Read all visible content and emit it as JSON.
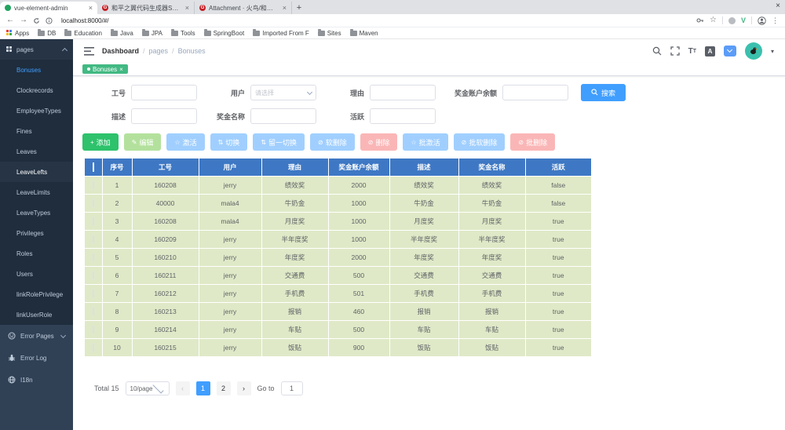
{
  "browser": {
    "tabs": [
      {
        "title": "vue-element-admin",
        "favicon": "green-dot",
        "active": true
      },
      {
        "title": "和平之翼代码生成器SMEU",
        "favicon": "gitee",
        "active": false
      },
      {
        "title": "Attachment · 火鸟/和平之翼",
        "favicon": "gitee",
        "active": false
      }
    ],
    "new_tab_label": "+",
    "window_close_label": "×",
    "url": "localhost:8000/#/",
    "bookmarks": [
      "Apps",
      "DB",
      "Education",
      "Java",
      "JPA",
      "Tools",
      "SpringBoot",
      "Imported From F",
      "Sites",
      "Maven"
    ]
  },
  "sidebar": {
    "group_label": "pages",
    "pages_items": [
      {
        "label": "Bonuses",
        "active": true,
        "hover": false
      },
      {
        "label": "Clockrecords",
        "active": false,
        "hover": false
      },
      {
        "label": "EmployeeTypes",
        "active": false,
        "hover": false
      },
      {
        "label": "Fines",
        "active": false,
        "hover": false
      },
      {
        "label": "Leaves",
        "active": false,
        "hover": false
      },
      {
        "label": "LeaveLefts",
        "active": false,
        "hover": true
      },
      {
        "label": "LeaveLimits",
        "active": false,
        "hover": false
      },
      {
        "label": "LeaveTypes",
        "active": false,
        "hover": false
      },
      {
        "label": "Privileges",
        "active": false,
        "hover": false
      },
      {
        "label": "Roles",
        "active": false,
        "hover": false
      },
      {
        "label": "Users",
        "active": false,
        "hover": false
      },
      {
        "label": "linkRolePrivilege",
        "active": false,
        "hover": false
      },
      {
        "label": "linkUserRole",
        "active": false,
        "hover": false
      }
    ],
    "other_items": [
      {
        "label": "Error Pages",
        "icon": "error-pages-icon",
        "chevron": true
      },
      {
        "label": "Error Log",
        "icon": "bug-icon",
        "chevron": false
      },
      {
        "label": "I18n",
        "icon": "globe-icon",
        "chevron": false
      }
    ]
  },
  "navbar": {
    "breadcrumb": [
      "Dashboard",
      "pages",
      "Bonuses"
    ],
    "separator": "/"
  },
  "tags": [
    {
      "label": "Bonuses",
      "close": "×",
      "active": true
    }
  ],
  "filter": {
    "rows": [
      [
        {
          "label": "工号",
          "type": "input"
        },
        {
          "label": "用户",
          "type": "select",
          "placeholder": "请选择"
        },
        {
          "label": "理由",
          "type": "input"
        },
        {
          "label": "奖金账户余额",
          "type": "input",
          "wide": true
        }
      ],
      [
        {
          "label": "描述",
          "type": "input"
        },
        {
          "label": "奖金名称",
          "type": "input"
        },
        {
          "label": "活跃",
          "type": "input"
        }
      ]
    ],
    "search_label": "搜索"
  },
  "toolbar": {
    "buttons": [
      {
        "label": "添加",
        "icon": "plus-icon",
        "style": "success"
      },
      {
        "label": "编辑",
        "icon": "edit-icon",
        "style": "success-disabled"
      },
      {
        "label": "激活",
        "icon": "star-icon",
        "style": "primary-disabled"
      },
      {
        "label": "切换",
        "icon": "toggle-icon",
        "style": "primary-disabled"
      },
      {
        "label": "留一切换",
        "icon": "toggle-icon",
        "style": "primary-disabled"
      },
      {
        "label": "软删除",
        "icon": "trash-icon",
        "style": "primary-disabled"
      },
      {
        "label": "删除",
        "icon": "trash-icon",
        "style": "danger-disabled"
      },
      {
        "label": "批激活",
        "icon": "star-icon",
        "style": "primary-disabled"
      },
      {
        "label": "批软删除",
        "icon": "trash-icon",
        "style": "primary-disabled"
      },
      {
        "label": "批删除",
        "icon": "trash-icon",
        "style": "danger-disabled"
      }
    ]
  },
  "table": {
    "headers": [
      "序号",
      "工号",
      "用户",
      "理由",
      "奖金账户余额",
      "描述",
      "奖金名称",
      "活跃"
    ],
    "rows": [
      [
        "1",
        "160208",
        "jerry",
        "绩效奖",
        "2000",
        "绩效奖",
        "绩效奖",
        "false"
      ],
      [
        "2",
        "40000",
        "mala4",
        "牛奶金",
        "1000",
        "牛奶金",
        "牛奶金",
        "false"
      ],
      [
        "3",
        "160208",
        "mala4",
        "月度奖",
        "1000",
        "月度奖",
        "月度奖",
        "true"
      ],
      [
        "4",
        "160209",
        "jerry",
        "半年度奖",
        "1000",
        "半年度奖",
        "半年度奖",
        "true"
      ],
      [
        "5",
        "160210",
        "jerry",
        "年度奖",
        "2000",
        "年度奖",
        "年度奖",
        "true"
      ],
      [
        "6",
        "160211",
        "jerry",
        "交通费",
        "500",
        "交通费",
        "交通费",
        "true"
      ],
      [
        "7",
        "160212",
        "jerry",
        "手机费",
        "501",
        "手机费",
        "手机费",
        "true"
      ],
      [
        "8",
        "160213",
        "jerry",
        "报销",
        "460",
        "报销",
        "报销",
        "true"
      ],
      [
        "9",
        "160214",
        "jerry",
        "车贴",
        "500",
        "车贴",
        "车贴",
        "true"
      ],
      [
        "10",
        "160215",
        "jerry",
        "饭贴",
        "900",
        "饭贴",
        "饭贴",
        "true"
      ]
    ]
  },
  "pagination": {
    "total": "Total 15",
    "page_size": "10/page",
    "prev": "‹",
    "next": "›",
    "pages": [
      "1",
      "2"
    ],
    "active_page": "1",
    "goto_label": "Go to",
    "goto_value": "1"
  },
  "colors": {
    "primary": "#409EFF",
    "success": "#2dc26b",
    "tag_active": "#42b983",
    "table_header": "#3e78c4",
    "table_row": "#dfe9c7",
    "sidebar_bg": "#304156",
    "submenu_bg": "#1f2d3d",
    "disabled_primary": "#a0cfff",
    "disabled_success": "#b3e19d",
    "disabled_danger": "#fab6b6"
  }
}
